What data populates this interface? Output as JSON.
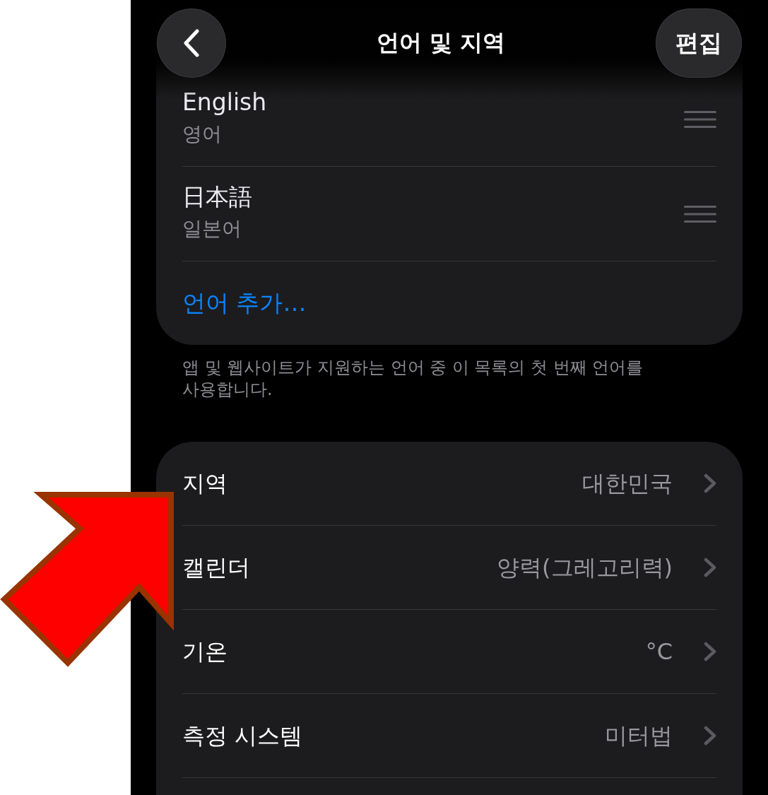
{
  "nav": {
    "title": "언어 및 지역",
    "edit_button": "편집"
  },
  "languages": [
    {
      "name": "English",
      "native_name": "영어"
    },
    {
      "name": "日本語",
      "native_name": "일본어"
    }
  ],
  "add_language": "언어 추가…",
  "language_note": "앱 및 웹사이트가 지원하는 언어 중 이 목록의 첫 번째 언어를 사용합니다.",
  "region_settings": [
    {
      "label": "지역",
      "value": "대한민국"
    },
    {
      "label": "캘린더",
      "value": "양력(그레고리력)"
    },
    {
      "label": "기온",
      "value": "°C"
    },
    {
      "label": "측정 시스템",
      "value": "미터법"
    }
  ],
  "annotation": {
    "kind": "arrow"
  }
}
